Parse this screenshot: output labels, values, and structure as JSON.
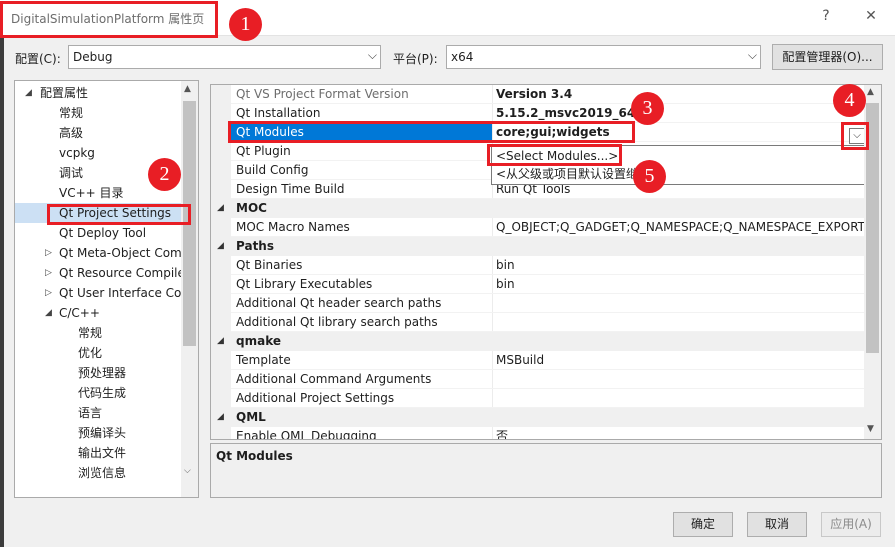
{
  "window": {
    "title": "DigitalSimulationPlatform 属性页",
    "help_glyph": "?",
    "close_glyph": "✕"
  },
  "config_bar": {
    "config_label": "配置(C):",
    "config_value": "Debug",
    "platform_label": "平台(P):",
    "platform_value": "x64",
    "manager_button": "配置管理器(O)..."
  },
  "tree": {
    "root": "配置属性",
    "items": [
      {
        "label": "常规"
      },
      {
        "label": "高级"
      },
      {
        "label": "vcpkg"
      },
      {
        "label": "调试"
      },
      {
        "label": "VC++ 目录"
      },
      {
        "label": "Qt Project Settings",
        "selected": true
      },
      {
        "label": "Qt Deploy Tool"
      },
      {
        "label": "Qt Meta-Object Com",
        "expandable": true
      },
      {
        "label": "Qt Resource Compile",
        "expandable": true
      },
      {
        "label": "Qt User Interface Co",
        "expandable": true
      },
      {
        "label": "C/C++",
        "expanded": true
      }
    ],
    "cpp_children": [
      {
        "label": "常规"
      },
      {
        "label": "优化"
      },
      {
        "label": "预处理器"
      },
      {
        "label": "代码生成"
      },
      {
        "label": "语言"
      },
      {
        "label": "预编译头"
      },
      {
        "label": "输出文件"
      },
      {
        "label": "浏览信息"
      }
    ]
  },
  "properties": {
    "rows": [
      {
        "name": "Qt VS Project Format Version",
        "value": "Version 3.4",
        "disabled": true,
        "value_bold": true
      },
      {
        "name": "Qt Installation",
        "value": "5.15.2_msvc2019_64",
        "value_bold": true
      },
      {
        "name": "Qt Modules",
        "value": "core;gui;widgets",
        "selected": true,
        "value_bold": true
      },
      {
        "name": "Qt Plugin",
        "value": ""
      },
      {
        "name": "Build Config",
        "value": ""
      },
      {
        "name": "Design Time Build",
        "value": "Run Qt Tools"
      },
      {
        "category": "MOC"
      },
      {
        "name": "MOC Macro Names",
        "value": "Q_OBJECT;Q_GADGET;Q_NAMESPACE;Q_NAMESPACE_EXPORT"
      },
      {
        "category": "Paths"
      },
      {
        "name": "Qt Binaries",
        "value": "bin"
      },
      {
        "name": "Qt Library Executables",
        "value": "bin"
      },
      {
        "name": "Additional Qt header search paths",
        "value": ""
      },
      {
        "name": "Additional Qt library search paths",
        "value": ""
      },
      {
        "category": "qmake"
      },
      {
        "name": "Template",
        "value": "MSBuild"
      },
      {
        "name": "Additional Command Arguments",
        "value": ""
      },
      {
        "name": "Additional Project Settings",
        "value": ""
      },
      {
        "category": "QML"
      },
      {
        "name": "Enable QML Debugging",
        "value": "否"
      }
    ],
    "dropdown": {
      "items": [
        "<Select Modules...>",
        "<从父级或项目默认设置继"
      ]
    }
  },
  "description": {
    "title": "Qt Modules"
  },
  "buttons": {
    "ok": "确定",
    "cancel": "取消",
    "apply": "应用(A)"
  },
  "annotations": [
    "1",
    "2",
    "3",
    "4",
    "5"
  ],
  "colors": {
    "annotation": "#e81e25",
    "selection": "#0078d7",
    "tree_selection": "#cce0f4"
  }
}
